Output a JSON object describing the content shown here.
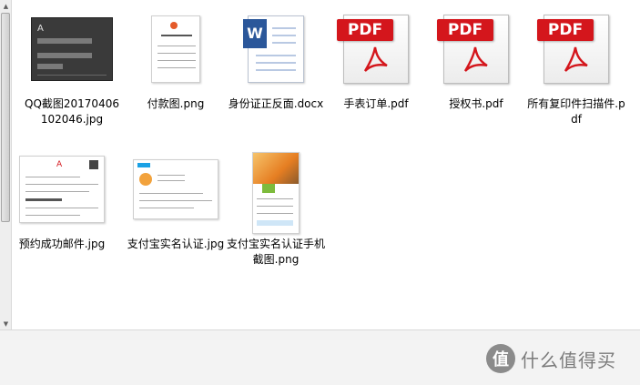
{
  "files": [
    {
      "name": "QQ截图20170406102046.jpg",
      "icon": "image-thumbnail"
    },
    {
      "name": "付款图.png",
      "icon": "image-thumbnail"
    },
    {
      "name": "身份证正反面.docx",
      "icon": "word-document-icon"
    },
    {
      "name": "手表订单.pdf",
      "icon": "pdf-icon"
    },
    {
      "name": "授权书.pdf",
      "icon": "pdf-icon"
    },
    {
      "name": "所有复印件扫描件.pdf",
      "icon": "pdf-icon"
    },
    {
      "name": "预约成功邮件.jpg",
      "icon": "image-thumbnail"
    },
    {
      "name": "支付宝实名认证.jpg",
      "icon": "image-thumbnail"
    },
    {
      "name": "支付宝实名认证手机截图.png",
      "icon": "image-thumbnail"
    }
  ],
  "icons": {
    "pdf_banner": "PDF",
    "word_badge": "W"
  },
  "watermark": {
    "logo_glyph": "值",
    "text": "什么值得买"
  },
  "colors": {
    "pdf_red": "#d4161c",
    "word_blue": "#2b579a",
    "pane_bg": "#ffffff"
  }
}
